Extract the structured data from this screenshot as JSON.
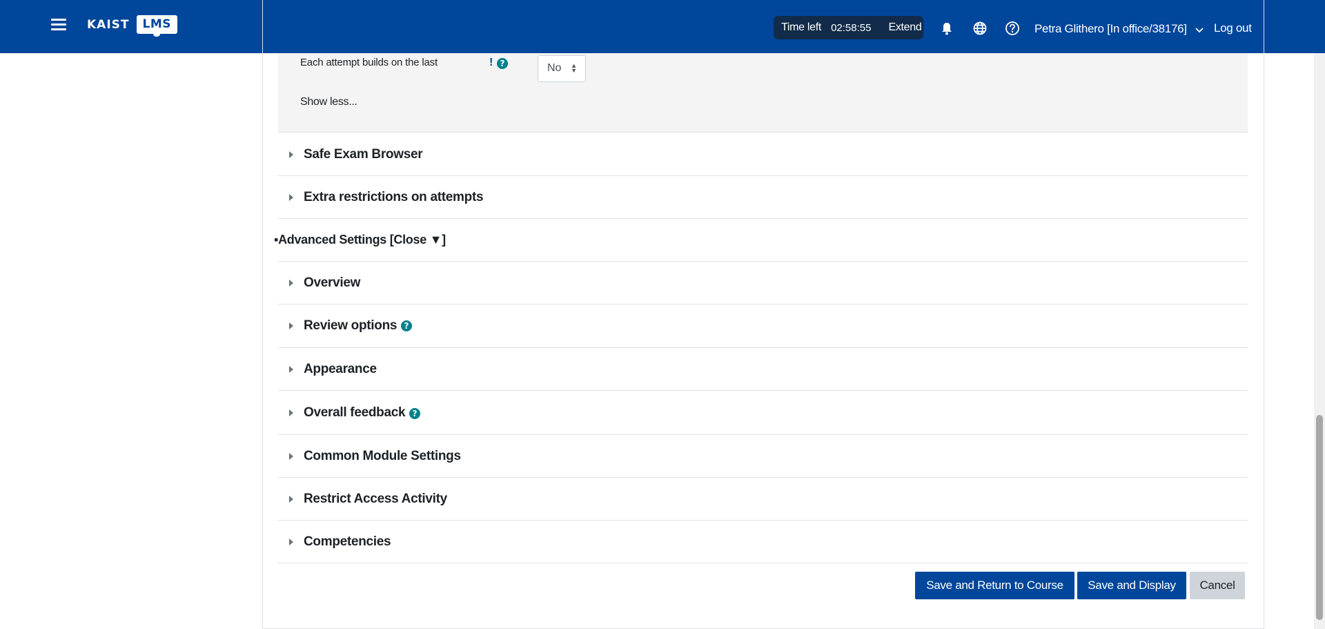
{
  "navbar": {
    "logo_text": "KAIST",
    "logo_badge": "LMS",
    "timer_label": "Time left",
    "timer_value": "02:58:55",
    "timer_extend": "Extend",
    "user_name": "Petra Glithero [In office/38176]",
    "logout_label": "Log out",
    "icons": [
      "menu-icon",
      "bell-icon",
      "globe-icon",
      "help-icon",
      "chevron-down-icon"
    ]
  },
  "settings_panel": {
    "field_label": "Each attempt builds on the last",
    "required_mark": "!",
    "select_value": "No",
    "show_less": "Show less..."
  },
  "sections_top": [
    {
      "title": "Safe Exam Browser"
    },
    {
      "title": "Extra restrictions on attempts"
    }
  ],
  "advanced_settings_label": "▪Advanced Settings [Close ▼]",
  "sections_advanced": [
    {
      "title": "Overview"
    },
    {
      "title": "Review options"
    },
    {
      "title": "Appearance"
    },
    {
      "title": "Overall feedback"
    },
    {
      "title": "Common Module Settings"
    },
    {
      "title": "Restrict Access Activity"
    },
    {
      "title": "Competencies"
    }
  ],
  "actions": {
    "save_return": "Save and Return to Course",
    "save_display": "Save and Display",
    "cancel": "Cancel"
  },
  "colors": {
    "navbar": "#00469b",
    "timer_bg": "#122b4a",
    "help_icon": "#00818c",
    "primary_button": "#00469b",
    "secondary_button": "#ced4da"
  }
}
